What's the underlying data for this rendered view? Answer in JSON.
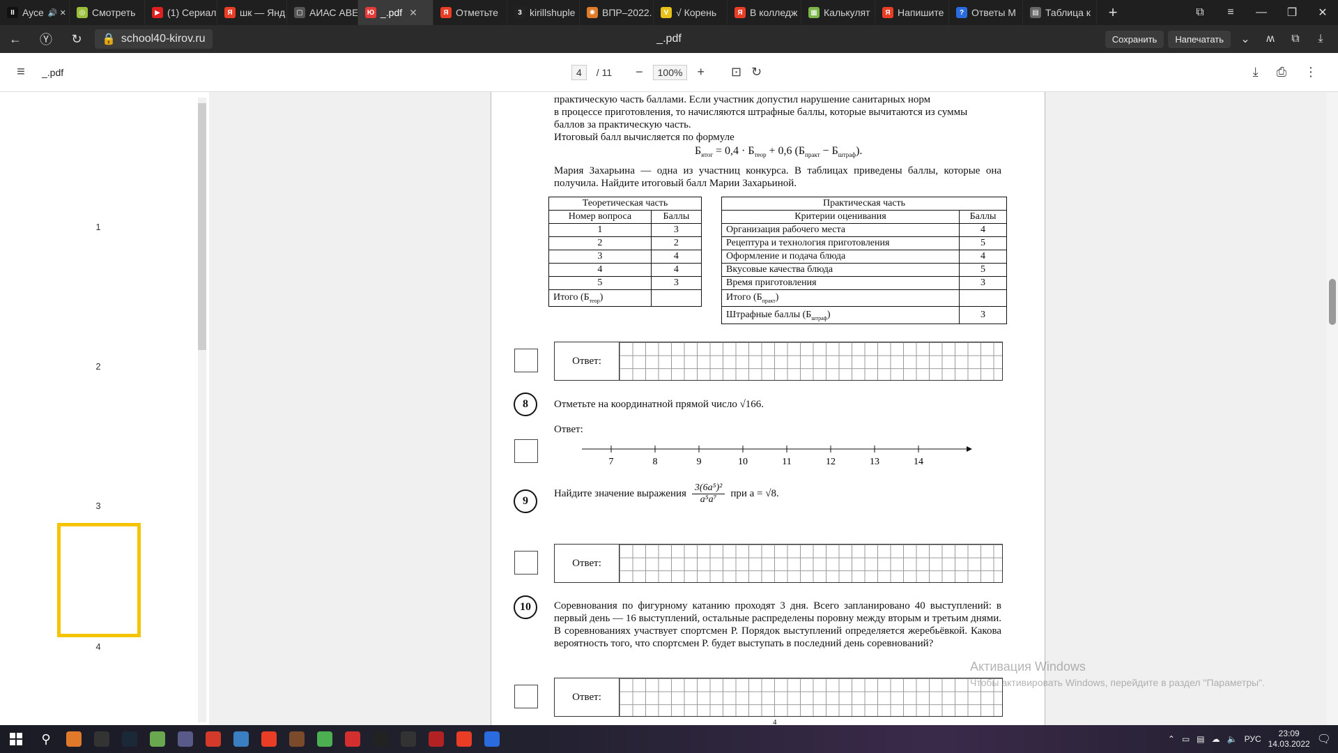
{
  "tabs": [
    {
      "label": "Аусе",
      "favicon_color": "#111111",
      "glyph": "II",
      "extra": "🔊 ✕"
    },
    {
      "label": "Смотреть",
      "favicon_color": "#9bbf3b",
      "glyph": "◎"
    },
    {
      "label": "(1) Сериал",
      "favicon_color": "#e02020",
      "glyph": "▶"
    },
    {
      "label": "шк — Янд",
      "favicon_color": "#e93d26",
      "glyph": "Я"
    },
    {
      "label": "АИАС АВЕ",
      "favicon_color": "#555555",
      "glyph": "▢"
    },
    {
      "label": "_.pdf",
      "favicon_color": "#e63b3b",
      "glyph": "Ю",
      "active": true
    },
    {
      "label": "Отметьте",
      "favicon_color": "#e93d26",
      "glyph": "Я"
    },
    {
      "label": "kirillshuple",
      "favicon_color": "#222222",
      "glyph": "3"
    },
    {
      "label": "ВПР–2022.",
      "favicon_color": "#e07b2a",
      "glyph": "✺"
    },
    {
      "label": "√ Корень",
      "favicon_color": "#e8c21a",
      "glyph": "V"
    },
    {
      "label": "В колледж",
      "favicon_color": "#e93d26",
      "glyph": "Я"
    },
    {
      "label": "Калькулят",
      "favicon_color": "#7ab648",
      "glyph": "▦"
    },
    {
      "label": "Напишите",
      "favicon_color": "#e93d26",
      "glyph": "Я"
    },
    {
      "label": "Ответы М",
      "favicon_color": "#2a6be0",
      "glyph": "?"
    },
    {
      "label": "Таблица к",
      "favicon_color": "#666666",
      "glyph": "▤"
    }
  ],
  "address": {
    "url": "school40-kirov.ru",
    "title": "_.pdf",
    "save": "Сохранить",
    "print": "Напечатать"
  },
  "pdf_toolbar": {
    "name": "_.pdf",
    "page_current": "4",
    "page_total": "/ 11",
    "zoom": "100%"
  },
  "thumbnails": [
    "1",
    "2",
    "3",
    "4"
  ],
  "page": {
    "intro_lines": [
      "практическую часть баллами. Если участник допустил нарушение санитарных норм",
      "в процессе приготовления, то начисляются штрафные баллы, которые вычитаются из суммы",
      "баллов за практическую часть."
    ],
    "formula_label": "Итоговый балл вычисляется по формуле",
    "formula": {
      "lhs": "Б",
      "lhs_sub": "итог",
      "a": " = 0,4 · Б",
      "a_sub": "теор",
      "b": " + 0,6 (Б",
      "b_sub": "практ",
      "c": " − Б",
      "c_sub": "штраф",
      "d": ")."
    },
    "maria_text": "Мария Захарьина — одна из участниц конкурса. В таблицах приведены баллы, которые она получила. Найдите итоговый балл Марии Захарьиной.",
    "theory": {
      "title": "Теоретическая часть",
      "col1": "Номер вопроса",
      "col2": "Баллы",
      "rows": [
        [
          "1",
          "3"
        ],
        [
          "2",
          "2"
        ],
        [
          "3",
          "4"
        ],
        [
          "4",
          "4"
        ],
        [
          "5",
          "3"
        ]
      ],
      "total": "Итого (Б",
      "total_sub": "теор",
      "total_close": ")"
    },
    "practice": {
      "title": "Практическая часть",
      "col1": "Критерии оценивания",
      "col2": "Баллы",
      "rows": [
        [
          "Организация рабочего места",
          "4"
        ],
        [
          "Рецептура и технология приготовления",
          "5"
        ],
        [
          "Оформление и подача блюда",
          "4"
        ],
        [
          "Вкусовые качества блюда",
          "5"
        ],
        [
          "Время приготовления",
          "3"
        ]
      ],
      "total": "Итого (Б",
      "total_sub": "практ",
      "total_close": ")",
      "penalty": "Штрафные баллы (Б",
      "penalty_sub": "штраф",
      "penalty_close": ")",
      "penalty_value": "3"
    },
    "answer_label": "Ответ:",
    "task8": {
      "num": "8",
      "text": "Отметьте на координатной прямой число √166.",
      "answer": "Ответ:",
      "ticks": [
        "7",
        "8",
        "9",
        "10",
        "11",
        "12",
        "13",
        "14"
      ]
    },
    "task9": {
      "num": "9",
      "text_before": "Найдите значение выражения",
      "num_expr": "3(6a⁵)²",
      "den_expr": "a⁵a⁷",
      "text_after": "при a = √8."
    },
    "task10": {
      "num": "10",
      "text": "Соревнования по фигурному катанию проходят 3 дня. Всего запланировано 40 выступлений: в первый день — 16 выступлений, остальные распределены поровну между вторым и третьим днями. В соревнованиях участвует спортсмен Р. Порядок выступлений определяется жеребьёвкой. Какова вероятность того, что спортсмен Р. будет выступать в последний день соревнований?"
    },
    "page_footer": "4"
  },
  "activation": {
    "title": "Активация Windows",
    "subtitle": "Чтобы активировать Windows, перейдите в раздел \"Параметры\"."
  },
  "taskbar": {
    "apps": [
      "#e07a2a",
      "#333333",
      "#1b2838",
      "#6aa84f",
      "#5a5a8a",
      "#d43a2a",
      "#3a7fc1",
      "#e93d26",
      "#7a4a2a",
      "#4caf50",
      "#d32f2f",
      "#222222",
      "#333333",
      "#b22222",
      "#e93d26",
      "#2a6be0"
    ],
    "lang": "РУС",
    "time": "23:09",
    "date": "14.03.2022"
  }
}
